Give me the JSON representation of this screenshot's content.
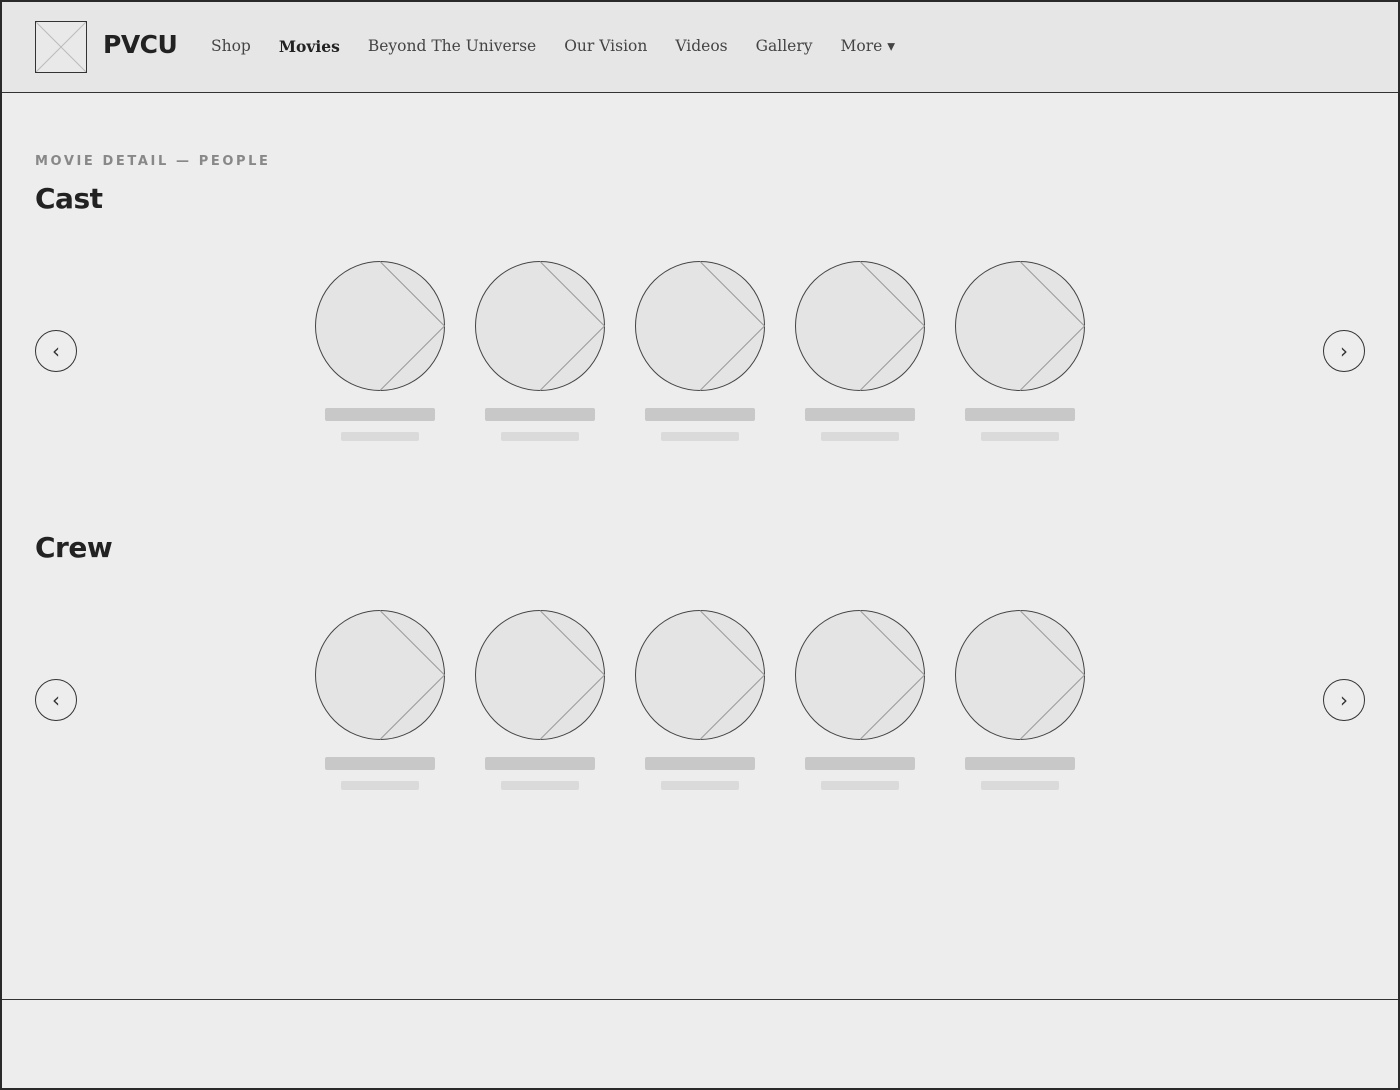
{
  "header": {
    "brand": "PVCU",
    "nav": [
      {
        "label": "Shop",
        "active": false
      },
      {
        "label": "Movies",
        "active": true
      },
      {
        "label": "Beyond The Universe",
        "active": false
      },
      {
        "label": "Our Vision",
        "active": false
      },
      {
        "label": "Videos",
        "active": false
      },
      {
        "label": "Gallery",
        "active": false
      },
      {
        "label": "More ▾",
        "active": false
      }
    ]
  },
  "page": {
    "eyebrow": "MOVIE DETAIL — PEOPLE"
  },
  "cast": {
    "title": "Cast",
    "prev_icon": "‹",
    "next_icon": "›",
    "count": 5
  },
  "crew": {
    "title": "Crew",
    "prev_icon": "‹",
    "next_icon": "›",
    "count": 5
  },
  "colors": {
    "background": "#ededed",
    "header_bg": "#e6e6e6",
    "placeholder_fill": "#e4e4e4",
    "line": "#333333"
  }
}
